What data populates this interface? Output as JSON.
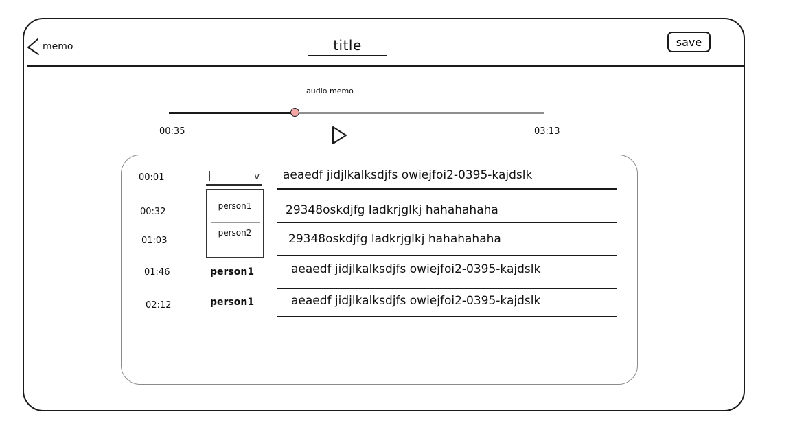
{
  "header": {
    "back_label": "memo",
    "title": "title",
    "save_label": "save"
  },
  "player": {
    "label": "audio memo",
    "elapsed": "00:35",
    "total": "03:13",
    "progress_fraction": 0.28
  },
  "speaker_select": {
    "options": [
      "person1",
      "person2"
    ]
  },
  "transcript": [
    {
      "time": "00:01",
      "speaker": "",
      "text": "aeaedf jidjlkalksdjfs owiejfoi2-0395-kajdslk"
    },
    {
      "time": "00:32",
      "speaker": "",
      "text": "29348oskdjfg ladkrjglkj hahahahaha"
    },
    {
      "time": "01:03",
      "speaker": "",
      "text": "29348oskdjfg ladkrjglkj hahahahaha"
    },
    {
      "time": "01:46",
      "speaker": "person1",
      "text": "aeaedf jidjlkalksdjfs owiejfoi2-0395-kajdslk"
    },
    {
      "time": "02:12",
      "speaker": "person1",
      "text": "aeaedf jidjlkalksdjfs owiejfoi2-0395-kajdslk"
    }
  ]
}
